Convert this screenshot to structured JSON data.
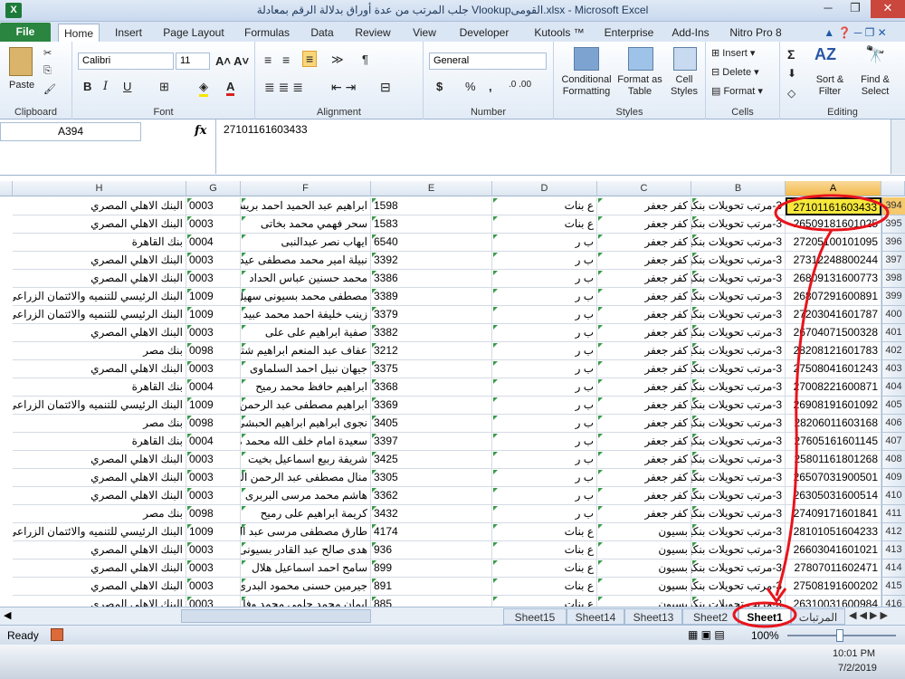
{
  "window": {
    "title": "جلب المرتب من عدة أوراق بدلالة الرقم  بمعادلة Vlookupالقومى.xlsx  -  Microsoft Excel",
    "controls": [
      "─",
      "❐",
      "✕"
    ]
  },
  "tabs": [
    "File",
    "Home",
    "Insert",
    "Page Layout",
    "Formulas",
    "Data",
    "Review",
    "View",
    "Developer",
    "Kutools ™",
    "Enterprise",
    "Add-Ins",
    "Nitro Pro 8"
  ],
  "ribbon": {
    "clipboard": {
      "label": "Clipboard",
      "paste": "Paste"
    },
    "font": {
      "label": "Font",
      "name": "Calibri",
      "size": "11",
      "bold": "B",
      "italic": "I",
      "underline": "U"
    },
    "alignment": {
      "label": "Alignment"
    },
    "number": {
      "label": "Number",
      "format": "General",
      "currency": "$",
      "percent": "%",
      "comma": ","
    },
    "styles": {
      "label": "Styles",
      "conditional": "Conditional Formatting",
      "format_table": "Format as Table",
      "cell_styles": "Cell Styles"
    },
    "cells": {
      "label": "Cells",
      "insert": "Insert",
      "delete": "Delete",
      "format": "Format"
    },
    "editing": {
      "label": "Editing",
      "sort": "Sort & Filter",
      "find": "Find & Select",
      "sigma": "Σ"
    }
  },
  "formula_bar": {
    "name_box": "A394",
    "fx": "fx",
    "formula": "27101161603433"
  },
  "columns": [
    "H",
    "G",
    "F",
    "E",
    "D",
    "C",
    "B",
    "A"
  ],
  "rows": [
    {
      "n": "394",
      "h": "البنك الاهلي المصري",
      "g": "0003",
      "f": "ابراهيم عبد الحميد احمد بريش",
      "e": "1598",
      "d": "ع   بنات",
      "c": "كفر جعفر",
      "b": "3-مرتب تحويلات بنكية",
      "a": "27101161603433"
    },
    {
      "n": "395",
      "h": "البنك الاهلي المصري",
      "g": "0003",
      "f": "سحر فهمي محمد بخاتى",
      "e": "1583",
      "d": "ع   بنات",
      "c": "كفر جعفر",
      "b": "3-مرتب تحويلات بنكية",
      "a": "26509181601025"
    },
    {
      "n": "396",
      "h": "بنك القاهرة",
      "g": "0004",
      "f": "ايهاب نصر عبدالنبى",
      "e": "6540",
      "d": "ب   ر",
      "c": "كفر جعفر",
      "b": "3-مرتب تحويلات بنكية",
      "a": "27205100101095"
    },
    {
      "n": "397",
      "h": "البنك الاهلي المصري",
      "g": "0003",
      "f": "نبيلة امير محمد مصطفى عيد",
      "e": "3392",
      "d": "ب   ر",
      "c": "كفر جعفر",
      "b": "3-مرتب تحويلات بنكية",
      "a": "27312248800244"
    },
    {
      "n": "398",
      "h": "البنك الاهلي المصري",
      "g": "0003",
      "f": "محمد حسنين عباس الحداد",
      "e": "3386",
      "d": "ب   ر",
      "c": "كفر جعفر",
      "b": "3-مرتب تحويلات بنكية",
      "a": "26809131600773"
    },
    {
      "n": "399",
      "h": "البنك الرئيسي للتنميه والائتمان الزراعى",
      "g": "1009",
      "f": "مصطفى محمد بسيونى سهيل",
      "e": "3389",
      "d": "ب   ر",
      "c": "كفر جعفر",
      "b": "3-مرتب تحويلات بنكية",
      "a": "26807291600891"
    },
    {
      "n": "400",
      "h": "البنك الرئيسي للتنميه والائتمان الزراعى",
      "g": "1009",
      "f": "زينب خليفة احمد محمد عبيد",
      "e": "3379",
      "d": "ب   ر",
      "c": "كفر جعفر",
      "b": "3-مرتب تحويلات بنكية",
      "a": "27203041601787"
    },
    {
      "n": "401",
      "h": "البنك الاهلي المصري",
      "g": "0003",
      "f": "صفية ابراهيم على على",
      "e": "3382",
      "d": "ب   ر",
      "c": "كفر جعفر",
      "b": "3-مرتب تحويلات بنكية",
      "a": "26704071500328"
    },
    {
      "n": "402",
      "h": "بنك مصر",
      "g": "0098",
      "f": "عفاف عبد المنعم ابراهيم شتية",
      "e": "3212",
      "d": "ب   ر",
      "c": "كفر جعفر",
      "b": "3-مرتب تحويلات بنكية",
      "a": "28208121601783"
    },
    {
      "n": "403",
      "h": "البنك الاهلي المصري",
      "g": "0003",
      "f": "جيهان نبيل احمد السلماوى",
      "e": "3375",
      "d": "ب   ر",
      "c": "كفر جعفر",
      "b": "3-مرتب تحويلات بنكية",
      "a": "27508041601243"
    },
    {
      "n": "404",
      "h": "بنك القاهرة",
      "g": "0004",
      "f": "ابراهيم حافظ محمد رميح",
      "e": "3368",
      "d": "ب   ر",
      "c": "كفر جعفر",
      "b": "3-مرتب تحويلات بنكية",
      "a": "27008221600871"
    },
    {
      "n": "405",
      "h": "البنك الرئيسي للتنميه والائتمان الزراعى",
      "g": "1009",
      "f": "ابراهيم مصطفى عبد الرحمن",
      "e": "3369",
      "d": "ب   ر",
      "c": "كفر جعفر",
      "b": "3-مرتب تحويلات بنكية",
      "a": "26908191601092"
    },
    {
      "n": "406",
      "h": "بنك مصر",
      "g": "0098",
      "f": "نجوى ابراهيم ابراهيم الحبشى",
      "e": "3405",
      "d": "ب   ر",
      "c": "كفر جعفر",
      "b": "3-مرتب تحويلات بنكية",
      "a": "28206011603168"
    },
    {
      "n": "407",
      "h": "بنك القاهرة",
      "g": "0004",
      "f": "سعيدة امام خلف الله محمد معلا",
      "e": "3397",
      "d": "ب   ر",
      "c": "كفر جعفر",
      "b": "3-مرتب تحويلات بنكية",
      "a": "27605161601145"
    },
    {
      "n": "408",
      "h": "البنك الاهلي المصري",
      "g": "0003",
      "f": "شريفة ربيع اسماعيل بخيت",
      "e": "3425",
      "d": "ب   ر",
      "c": "كفر جعفر",
      "b": "3-مرتب تحويلات بنكية",
      "a": "25801161801268"
    },
    {
      "n": "409",
      "h": "البنك الاهلي المصري",
      "g": "0003",
      "f": "منال مصطفى عبد الرحمن النا",
      "e": "3305",
      "d": "ب   ر",
      "c": "كفر جعفر",
      "b": "3-مرتب تحويلات بنكية",
      "a": "26507031900501"
    },
    {
      "n": "410",
      "h": "البنك الاهلي المصري",
      "g": "0003",
      "f": "هاشم محمد مرسى البربرى",
      "e": "3362",
      "d": "ب   ر",
      "c": "كفر جعفر",
      "b": "3-مرتب تحويلات بنكية",
      "a": "26305031600514"
    },
    {
      "n": "411",
      "h": "بنك مصر",
      "g": "0098",
      "f": "كريمة ابراهيم على رميح",
      "e": "3432",
      "d": "ب   ر",
      "c": "كفر جعفر",
      "b": "3-مرتب تحويلات بنكية",
      "a": "27409171601841"
    },
    {
      "n": "412",
      "h": "البنك الرئيسي للتنميه والائتمان الزراعى",
      "g": "1009",
      "f": "طارق مصطفى مرسى عبد ال",
      "e": "4174",
      "d": "ع بنات",
      "c": "بسيون",
      "b": "3-مرتب تحويلات بنكية",
      "a": "28101051604233"
    },
    {
      "n": "413",
      "h": "البنك الاهلي المصري",
      "g": "0003",
      "f": "هدى صالح عبد القادر بسيونى",
      "e": "936",
      "d": "ع بنات",
      "c": "بسيون",
      "b": "3-مرتب تحويلات بنكية",
      "a": "26603041601021"
    },
    {
      "n": "414",
      "h": "البنك الاهلي المصري",
      "g": "0003",
      "f": "سامح احمد اسماعيل هلال",
      "e": "899",
      "d": "ع بنات",
      "c": "بسيون",
      "b": "3-مرتب تحويلات بنكية",
      "a": "27807011602471"
    },
    {
      "n": "415",
      "h": "البنك الاهلي المصري",
      "g": "0003",
      "f": "جيرمين حسنى محمود البدرى",
      "e": "891",
      "d": "ع بنات",
      "c": "بسيون",
      "b": "3-مرتب تحويلات بنكية",
      "a": "27508191600202"
    },
    {
      "n": "416",
      "h": "البنك الاهلي المصري",
      "g": "0003",
      "f": "ايمان محمد حلمى محمد وفا",
      "e": "885",
      "d": "ع بنات",
      "c": "بسيون",
      "b": "3-مرتب تحويلات بنكية",
      "a": "26310031600984"
    }
  ],
  "sheets": [
    "Sheet15",
    "Sheet14",
    "Sheet13",
    "Sheet2",
    "Sheet1",
    "المرتبات"
  ],
  "active_sheet": "Sheet1",
  "status": {
    "ready": "Ready",
    "zoom": "100%"
  },
  "taskbar": {
    "time": "10:01 PM",
    "date": "7/2/2019"
  },
  "colors": {
    "selection": "#f5e83a",
    "annotation": "#e8141b",
    "file_tab": "#2a8540"
  }
}
